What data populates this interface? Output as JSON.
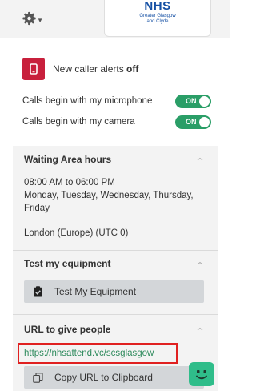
{
  "header": {
    "settings_icon": "gear-icon",
    "logo_title": "NHS",
    "logo_line1": "Greater Glasgow",
    "logo_line2": "and Clyde"
  },
  "alerts": {
    "icon": "phone-icon",
    "label": "New caller alerts",
    "state": "off"
  },
  "toggles": [
    {
      "label": "Calls begin with my microphone",
      "state": "ON"
    },
    {
      "label": "Calls begin with my camera",
      "state": "ON"
    }
  ],
  "waiting_area": {
    "title": "Waiting Area hours",
    "hours": "08:00 AM to 06:00 PM",
    "days": "Monday, Tuesday, Wednesday, Thursday, Friday",
    "timezone": "London (Europe) (UTC 0)"
  },
  "equipment": {
    "title": "Test my equipment",
    "button_label": "Test My Equipment"
  },
  "url_section": {
    "title": "URL to give people",
    "url": "https://nhsattend.vc/scsglasgow",
    "copy_label": "Copy URL to Clipboard"
  },
  "colors": {
    "accent_green": "#2a9e67",
    "alert_red": "#c8203c",
    "link_green": "#2d8a5c",
    "highlight_red": "#e02020",
    "chat_green": "#2fbd8a"
  }
}
